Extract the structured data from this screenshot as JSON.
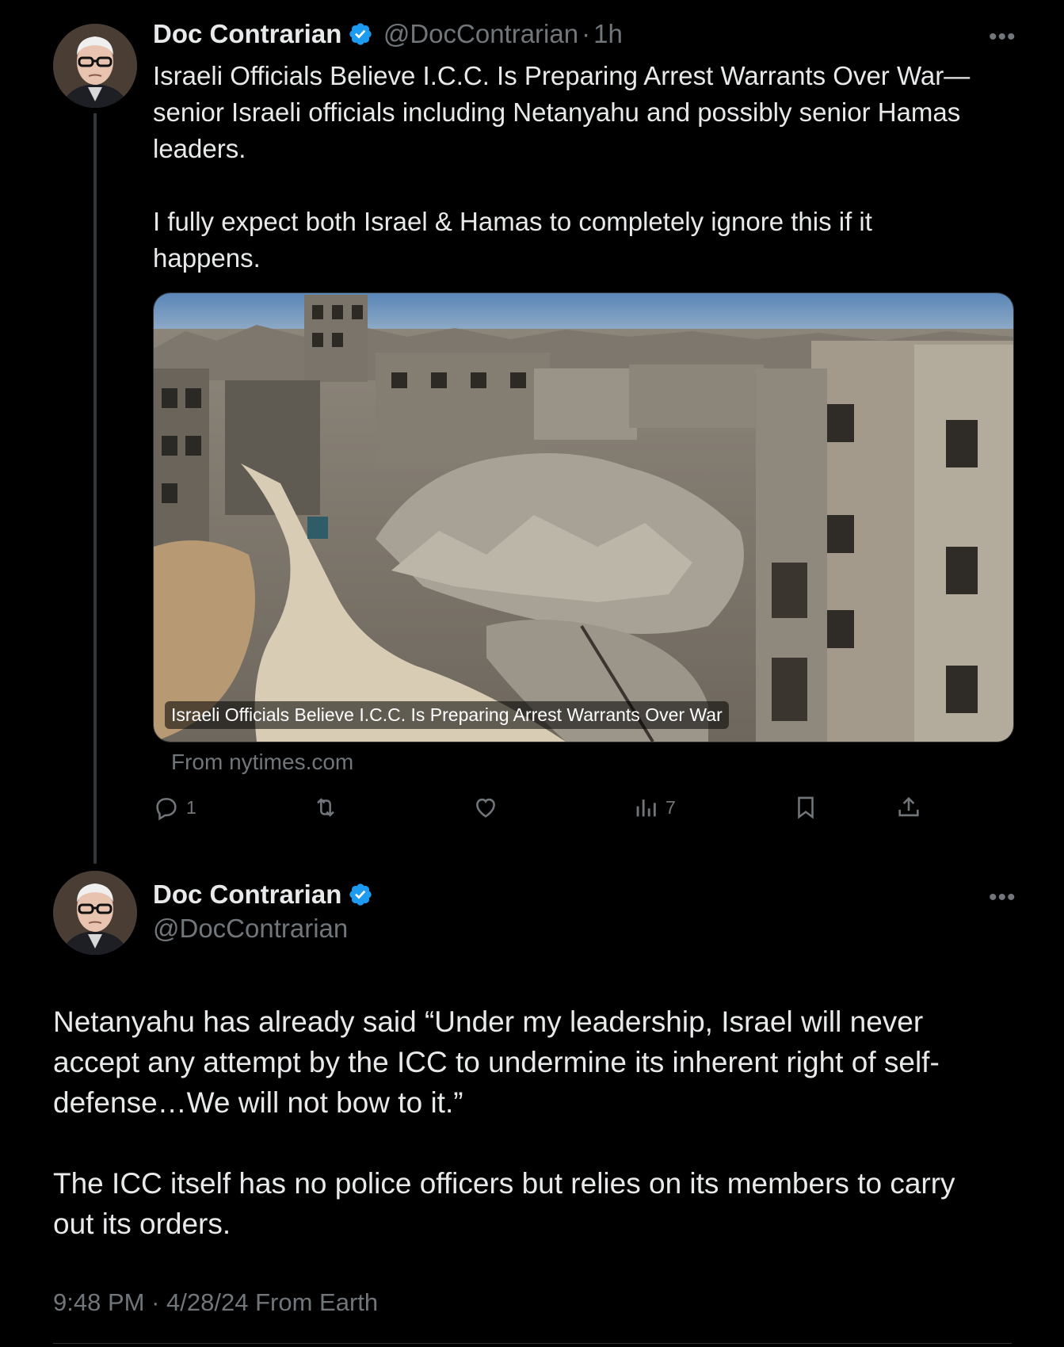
{
  "colors": {
    "background": "#000000",
    "text": "#e7e9ea",
    "muted": "#71767b",
    "verified": "#1d9bf0",
    "line": "#333639"
  },
  "tweet": {
    "author_name": "Doc Contrarian",
    "handle": "@DocContrarian",
    "time_sep": "·",
    "time": "1h",
    "text": "Israeli Officials Believe I.C.C. Is Preparing Arrest Warrants Over War—\nsenior Israeli officials including Netanyahu and possibly senior Hamas\nleaders.\n\nI fully expect both Israel & Hamas to completely ignore this if it\nhappens.",
    "card_caption": "Israeli Officials Believe I.C.C. Is Preparing Arrest Warrants Over War",
    "card_source": "From nytimes.com",
    "actions": {
      "reply_count": "1",
      "repost_count": "",
      "like_count": "",
      "views_count": "7"
    },
    "icons": [
      "reply-icon",
      "repost-icon",
      "like-icon",
      "views-icon",
      "bookmark-icon",
      "share-icon",
      "more-icon",
      "verified-badge-icon"
    ]
  },
  "reply": {
    "author_name": "Doc Contrarian",
    "handle": "@DocContrarian",
    "text": "Netanyahu has already said “Under my leadership, Israel will never\naccept any attempt by the ICC to undermine its inherent right of self-\ndefense…We will not bow to it.”\n\nThe ICC itself has no police officers but relies on its members to carry\nout its orders.",
    "time": "9:48 PM",
    "sep": "·",
    "date": "4/28/24",
    "location": "From Earth"
  }
}
